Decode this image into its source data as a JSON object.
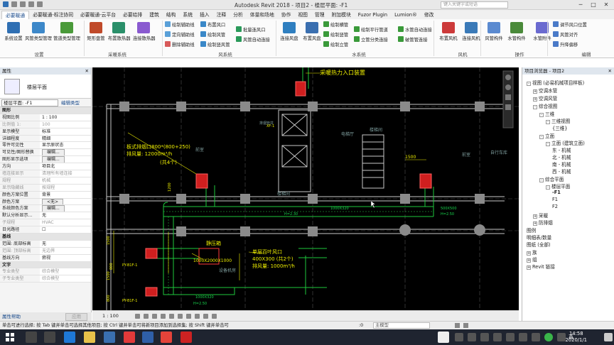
{
  "window": {
    "title": "Autodesk Revit 2018 -   项目2 - 楼层平面: -F1",
    "search_placeholder": "键入关键字或短语",
    "minimize": "─",
    "maximize": "□",
    "close": "✕"
  },
  "tabs": [
    "必要暖通",
    "必要暖通-标注协同",
    "必要暖通-云平台",
    "必要给排",
    "建筑",
    "结构",
    "系统",
    "插入",
    "注释",
    "分析",
    "体量和场地",
    "协作",
    "视图",
    "管理",
    "附加模块",
    "Fuzor Plugin",
    "Lumion®",
    "修改"
  ],
  "active_tab": 0,
  "ribbon": {
    "groups": {
      "settings": "设置",
      "hvac_system": "采暖系统",
      "air_system": "风系统",
      "water_system": "水系统",
      "fan": "风机",
      "operation": "操作",
      "edit": "编辑"
    },
    "big_buttons": [
      {
        "label": "系统设置",
        "color": "#2f6fb3"
      },
      {
        "label": "风管类型管理",
        "color": "#3d88c9"
      },
      {
        "label": "管道类型管理",
        "color": "#4a9a3a"
      },
      {
        "label": "矩形盘管",
        "color": "#c04a2a"
      },
      {
        "label": "布置散热器",
        "color": "#2a8f6a"
      },
      {
        "label": "连接散热器",
        "color": "#8a5ad0"
      },
      {
        "label": "连接风盘",
        "color": "#2f7fc0"
      },
      {
        "label": "布置风盘",
        "color": "#3a6fb0"
      },
      {
        "label": "布置风机",
        "color": "#cc3a3a"
      },
      {
        "label": "连接风机",
        "color": "#3a7ab8"
      },
      {
        "label": "风管构件",
        "color": "#5a8ad0"
      },
      {
        "label": "水管构件",
        "color": "#4a8a3a"
      },
      {
        "label": "水管附件",
        "color": "#6a6ad0"
      }
    ],
    "small_buttons": [
      {
        "label": "绘制辅助线",
        "color": "#5aa0d8"
      },
      {
        "label": "定向辅助线",
        "color": "#5aa0d8"
      },
      {
        "label": "删除辅助线",
        "color": "#d85a5a"
      },
      {
        "label": "布置风口",
        "color": "#3a88c8"
      },
      {
        "label": "绘制风管",
        "color": "#3a88c8"
      },
      {
        "label": "绘制竖风管",
        "color": "#3a88c8"
      },
      {
        "label": "批量连风口",
        "color": "#2a9a5a"
      },
      {
        "label": "风管自动连接",
        "color": "#2a9a5a"
      },
      {
        "label": "绘制横管",
        "color": "#3a9a3a"
      },
      {
        "label": "绘制竖管",
        "color": "#3a9a3a"
      },
      {
        "label": "绘制立管",
        "color": "#3a9a3a"
      },
      {
        "label": "绘制平行管道",
        "color": "#3a9a3a"
      },
      {
        "label": "立管分类连接",
        "color": "#3a9a3a"
      },
      {
        "label": "水管自动连接",
        "color": "#3a9a3a"
      },
      {
        "label": "破管管连接",
        "color": "#3a9a3a"
      },
      {
        "label": "调节风口位置",
        "color": "#4a7ac8"
      },
      {
        "label": "风管对齐",
        "color": "#4a7ac8"
      },
      {
        "label": "升降偏移",
        "color": "#4a7ac8"
      }
    ]
  },
  "properties": {
    "header": "属性",
    "type_name": "楼层平面",
    "view_selector": "楼层平面: -F1",
    "edit_type": "编辑类型",
    "rows": [
      {
        "k": "图形",
        "v": "",
        "cat": true
      },
      {
        "k": "视图比例",
        "v": "1 : 100",
        "input": true
      },
      {
        "k": "比例值 1:",
        "v": "100",
        "grey": true
      },
      {
        "k": "显示模型",
        "v": "标准"
      },
      {
        "k": "详细程度",
        "v": "精细"
      },
      {
        "k": "零件可见性",
        "v": "显示原状态"
      },
      {
        "k": "可见性/图形替换",
        "v": "编辑...",
        "button": true
      },
      {
        "k": "图形显示选项",
        "v": "编辑...",
        "button": true
      },
      {
        "k": "方向",
        "v": "项目北"
      },
      {
        "k": "墙连接显示",
        "v": "清理所有墙连接",
        "grey": true
      },
      {
        "k": "规程",
        "v": "机械",
        "grey": true
      },
      {
        "k": "显示隐藏线",
        "v": "按规程",
        "grey": true
      },
      {
        "k": "颜色方案位置",
        "v": "背景"
      },
      {
        "k": "颜色方案",
        "v": "<无>",
        "button": true
      },
      {
        "k": "系统颜色方案",
        "v": "编辑...",
        "button": true
      },
      {
        "k": "默认分析显示...",
        "v": "无"
      },
      {
        "k": "子规程",
        "v": "HVAC",
        "grey": true
      },
      {
        "k": "日光路径",
        "v": "☐"
      },
      {
        "k": "基线",
        "v": "",
        "cat": true
      },
      {
        "k": "范围: 底部标高",
        "v": "无"
      },
      {
        "k": "范围: 顶部标高",
        "v": "无边界",
        "grey": true
      },
      {
        "k": "基线方向",
        "v": "俯视"
      },
      {
        "k": "文字",
        "v": "",
        "cat": true
      },
      {
        "k": "专业类型",
        "v": "综合模型",
        "grey": true
      },
      {
        "k": "子专业类型",
        "v": "综合模型",
        "grey": true
      }
    ],
    "help": "属性帮助",
    "apply": "应用"
  },
  "canvas": {
    "labels": [
      {
        "text": "采暖热力入口装置",
        "cls": "ctxt"
      },
      {
        "text": "板式排烟口800*(800+250)",
        "cls": "ctxt"
      },
      {
        "text": "排风量: 12000m³/h",
        "cls": "ctxt"
      },
      {
        "text": "(共4个)",
        "cls": "ctxt"
      },
      {
        "text": "静压箱",
        "cls": "ctxt"
      },
      {
        "text": "1000X2000X1000",
        "cls": "ctxt"
      },
      {
        "text": "单层百叶风口",
        "cls": "ctxt"
      },
      {
        "text": "400X300  (共2个)",
        "cls": "ctxt"
      },
      {
        "text": "排风量: 1000m³/h",
        "cls": "ctxt"
      },
      {
        "text": "1500",
        "cls": "ctxt"
      },
      {
        "text": "1200",
        "cls": "ctxt"
      },
      {
        "text": "1000X320",
        "cls": "gtxt"
      },
      {
        "text": "H=2.30",
        "cls": "gtxt"
      },
      {
        "text": "1000X320",
        "cls": "gtxt"
      },
      {
        "text": "H=2.50",
        "cls": "gtxt"
      },
      {
        "text": "500X500",
        "cls": "gtxt"
      },
      {
        "text": "H=2.50",
        "cls": "gtxt"
      },
      {
        "text": "800",
        "cls": "ctxt"
      },
      {
        "text": "1500",
        "cls": "ctxt"
      },
      {
        "text": "1500",
        "cls": "ctxt"
      },
      {
        "text": "800",
        "cls": "ctxt"
      },
      {
        "text": "PY-B1F-1",
        "cls": "ctxt"
      },
      {
        "text": "PY-B1F-1",
        "cls": "ctxt"
      },
      {
        "text": "XF-1",
        "cls": "ctxt"
      },
      {
        "text": "前室",
        "cls": "ltxt"
      },
      {
        "text": "前室",
        "cls": "ltxt"
      },
      {
        "text": "排烟管井",
        "cls": "ltxt"
      },
      {
        "text": "自行车库",
        "cls": "ltxt"
      },
      {
        "text": "设备机房",
        "cls": "ltxt"
      },
      {
        "text": "楼梯间",
        "cls": "ltxt"
      },
      {
        "text": "楼梯间",
        "cls": "ltxt"
      },
      {
        "text": "电梯厅",
        "cls": "ltxt"
      }
    ]
  },
  "view_control": {
    "scale": "1 : 100"
  },
  "browser": {
    "header": "项目浏览器 - 项目2",
    "nodes": [
      {
        "label": "视图 (必易机械项目样板)",
        "depth": 0,
        "box": "-"
      },
      {
        "label": "空调水管",
        "depth": 1,
        "box": "+"
      },
      {
        "label": "空调风管",
        "depth": 1,
        "box": "+"
      },
      {
        "label": "综合视图",
        "depth": 1,
        "box": "-"
      },
      {
        "label": "三维",
        "depth": 2,
        "box": "-"
      },
      {
        "label": "三维视图",
        "depth": 3,
        "box": "-"
      },
      {
        "label": "{三维}",
        "depth": 4,
        "box": ""
      },
      {
        "label": "立面",
        "depth": 2,
        "box": "-"
      },
      {
        "label": "立面 (建筑立面)",
        "depth": 3,
        "box": "-"
      },
      {
        "label": "东 - 机械",
        "depth": 4,
        "box": ""
      },
      {
        "label": "北 - 机械",
        "depth": 4,
        "box": ""
      },
      {
        "label": "南 - 机械",
        "depth": 4,
        "box": ""
      },
      {
        "label": "西 - 机械",
        "depth": 4,
        "box": ""
      },
      {
        "label": "综合平面",
        "depth": 2,
        "box": "-"
      },
      {
        "label": "楼层平面",
        "depth": 3,
        "box": "-"
      },
      {
        "label": "-F1",
        "depth": 4,
        "box": "",
        "bold": true
      },
      {
        "label": "F1",
        "depth": 4,
        "box": ""
      },
      {
        "label": "F2",
        "depth": 4,
        "box": ""
      },
      {
        "label": "采暖",
        "depth": 1,
        "box": "+"
      },
      {
        "label": "防排烟",
        "depth": 1,
        "box": "+"
      },
      {
        "label": "图例",
        "depth": 0,
        "box": ""
      },
      {
        "label": "明细表/数量",
        "depth": 0,
        "box": ""
      },
      {
        "label": "图纸 (全部)",
        "depth": 0,
        "box": ""
      },
      {
        "label": "族",
        "depth": 0,
        "box": "+"
      },
      {
        "label": "组",
        "depth": 0,
        "box": "+"
      },
      {
        "label": "Revit 链接",
        "depth": 0,
        "box": "+"
      }
    ]
  },
  "status": {
    "text": "单击可进行选择; 按 Tab 键并单击可选择其他项目; 按 Ctrl 键并单击可将新项目添加到选择集; 按 Shift 键并单击可",
    "model": "主模型",
    "zoom": ":0"
  },
  "taskbar": {
    "time": "14:58",
    "date": "2020/1/1",
    "lang": "英"
  }
}
